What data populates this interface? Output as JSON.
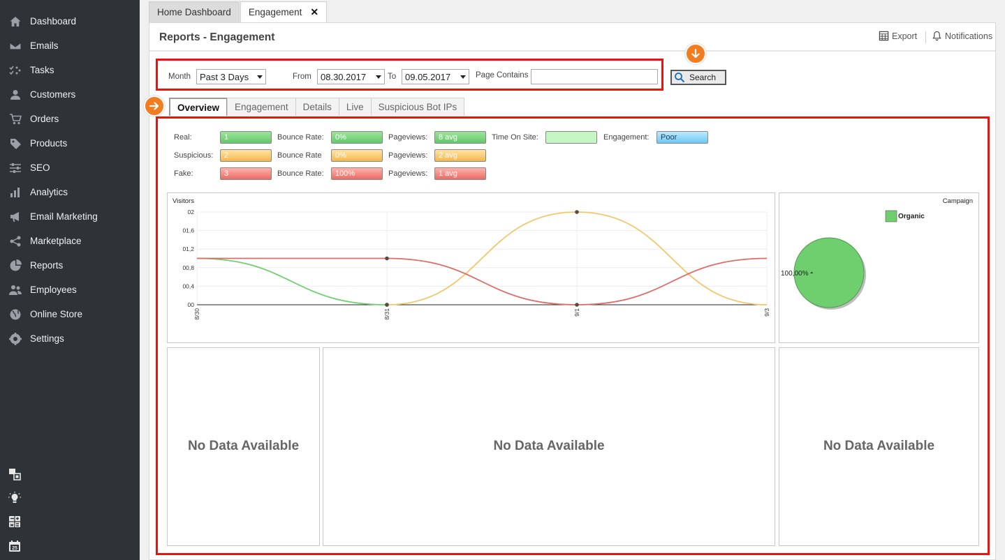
{
  "sidebar": {
    "items": [
      {
        "label": "Dashboard",
        "icon": "home-icon"
      },
      {
        "label": "Emails",
        "icon": "envelope-icon"
      },
      {
        "label": "Tasks",
        "icon": "tasks-icon"
      },
      {
        "label": "Customers",
        "icon": "user-icon"
      },
      {
        "label": "Orders",
        "icon": "cart-icon"
      },
      {
        "label": "Products",
        "icon": "tag-icon"
      },
      {
        "label": "SEO",
        "icon": "sliders-icon"
      },
      {
        "label": "Analytics",
        "icon": "bar-chart-icon"
      },
      {
        "label": "Email Marketing",
        "icon": "megaphone-icon"
      },
      {
        "label": "Marketplace",
        "icon": "share-icon"
      },
      {
        "label": "Reports",
        "icon": "pie-icon"
      },
      {
        "label": "Employees",
        "icon": "users-icon"
      },
      {
        "label": "Online Store",
        "icon": "globe-icon"
      },
      {
        "label": "Settings",
        "icon": "gear-icon"
      }
    ],
    "bottom_icons": [
      "windows-icon",
      "lightbulb-icon",
      "calculator-icon",
      "calendar-icon"
    ],
    "calendar_day": "25"
  },
  "tabs": {
    "home": "Home Dashboard",
    "engagement": "Engagement",
    "close": "✕"
  },
  "header": {
    "title": "Reports - Engagement",
    "export": "Export",
    "notifications": "Notifications"
  },
  "filters": {
    "month_label": "Month",
    "month_value": "Past 3 Days",
    "from_label": "From",
    "from_value": "08.30.2017",
    "to_label": "To",
    "to_value": "09.05.2017",
    "page_contains_label": "Page Contains",
    "page_contains_value": "",
    "search_label": "Search"
  },
  "subtabs": [
    "Overview",
    "Engagement",
    "Details",
    "Live",
    "Suspicious Bot IPs"
  ],
  "stats": {
    "real": {
      "label": "Real:",
      "value": "1",
      "bounce_label": "Bounce Rate:",
      "bounce": "0%",
      "pv_label": "Pageviews:",
      "pv": "8 avg"
    },
    "suspicious": {
      "label": "Suspicious:",
      "value": "2",
      "bounce_label": "Bounce Rate",
      "bounce": "0%",
      "pv_label": "Pageviews:",
      "pv": "2 avg"
    },
    "fake": {
      "label": "Fake:",
      "value": "3",
      "bounce_label": "Bounce Rate:",
      "bounce": "100%",
      "pv_label": "Pageviews:",
      "pv": "1 avg"
    },
    "time_on_site_label": "Time On Site:",
    "time_on_site": "",
    "engagement_label": "Engagement:",
    "engagement": "Poor"
  },
  "colors": {
    "green": "#6fcf6f",
    "orange": "#f2c66b",
    "red": "#e06a65",
    "accent_red": "#e11111",
    "accent_orange": "#f47c20"
  },
  "chart_data": [
    {
      "type": "line",
      "title": "Visitors",
      "x": [
        "8/30",
        "8/31",
        "9/1",
        "9/3"
      ],
      "y_ticks": [
        "00",
        "00,4",
        "00,8",
        "01,2",
        "01,6",
        "02"
      ],
      "ylim": [
        0,
        2
      ],
      "series": [
        {
          "values": [
            1,
            0,
            null,
            null
          ],
          "color": "#6fcf6f"
        },
        {
          "values": [
            null,
            0,
            2,
            0
          ],
          "color": "#f2c66b"
        },
        {
          "values": [
            1,
            1,
            0,
            1
          ],
          "color": "#e06a65"
        }
      ],
      "grid": true
    },
    {
      "type": "pie",
      "title": "Campaign",
      "slices": [
        {
          "name": "Organic",
          "value": 100,
          "label": "100,00%",
          "color": "#6fcf6f"
        }
      ],
      "legend": "top-right"
    }
  ],
  "nodata": [
    "No Data Available",
    "No Data Available",
    "No Data Available"
  ]
}
